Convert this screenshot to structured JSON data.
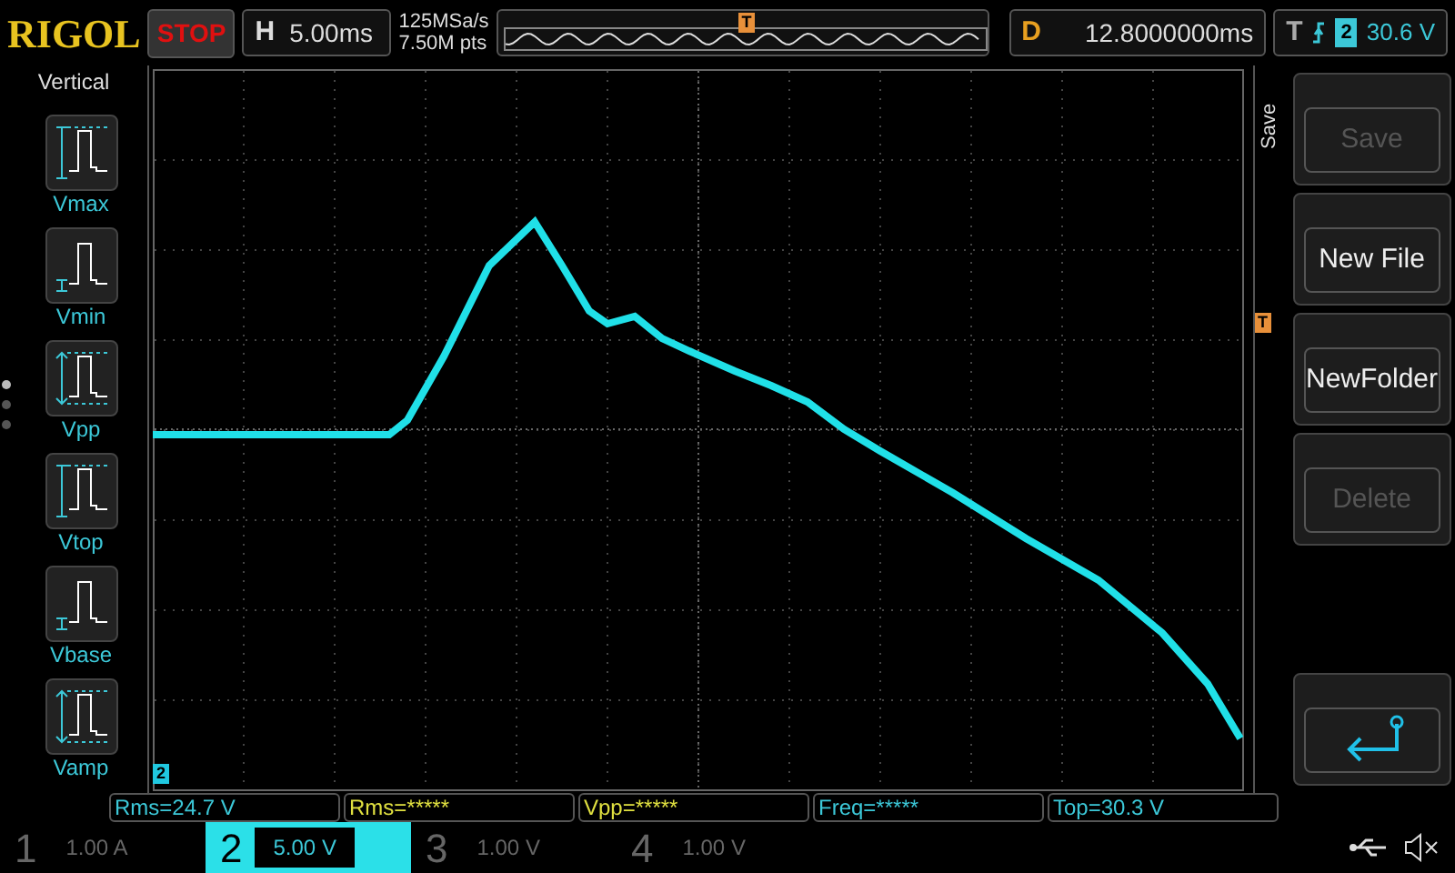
{
  "brand": "RIGOL",
  "run_state": "STOP",
  "horizontal": {
    "label": "H",
    "value": "5.00ms"
  },
  "sample_rate": "125MSa/s",
  "memory_depth": "7.50M pts",
  "trigger_position_marker": "T",
  "delay": {
    "label": "D",
    "value": "12.8000000ms"
  },
  "trigger": {
    "label": "T",
    "source": "2",
    "level": "30.6 V"
  },
  "left_menu": {
    "title": "Vertical",
    "pages": [
      {
        "selected": true
      },
      {
        "selected": false
      },
      {
        "selected": false
      }
    ],
    "items": [
      {
        "label": "Vmax",
        "kind": "vmax"
      },
      {
        "label": "Vmin",
        "kind": "vmin"
      },
      {
        "label": "Vpp",
        "kind": "vpp"
      },
      {
        "label": "Vtop",
        "kind": "vmax"
      },
      {
        "label": "Vbase",
        "kind": "vmin"
      },
      {
        "label": "Vamp",
        "kind": "vpp"
      }
    ]
  },
  "screen": {
    "trigger_level_marker": "T",
    "channel_marker": "2"
  },
  "right_menu": {
    "title": "Save",
    "buttons": [
      {
        "label": "Save",
        "disabled": true
      },
      {
        "label": "New File",
        "disabled": false
      },
      {
        "label": "NewFolder",
        "disabled": false
      },
      {
        "label": "Delete",
        "disabled": true
      }
    ]
  },
  "measurements": [
    {
      "text": "Rms=24.7 V",
      "color": "#3cc8d8"
    },
    {
      "text": "Rms=*****",
      "color": "#e0e040"
    },
    {
      "text": "Vpp=*****",
      "color": "#e0e040"
    },
    {
      "text": "Freq=*****",
      "color": "#3cc8d8"
    },
    {
      "text": "Top=30.3 V",
      "color": "#3cc8d8"
    }
  ],
  "channels": [
    {
      "number": "1",
      "scale": "1.00 A",
      "active": false
    },
    {
      "number": "2",
      "scale": "5.00 V",
      "active": true
    },
    {
      "number": "3",
      "scale": "1.00 V",
      "active": false
    },
    {
      "number": "4",
      "scale": "1.00 V",
      "active": false
    }
  ]
}
